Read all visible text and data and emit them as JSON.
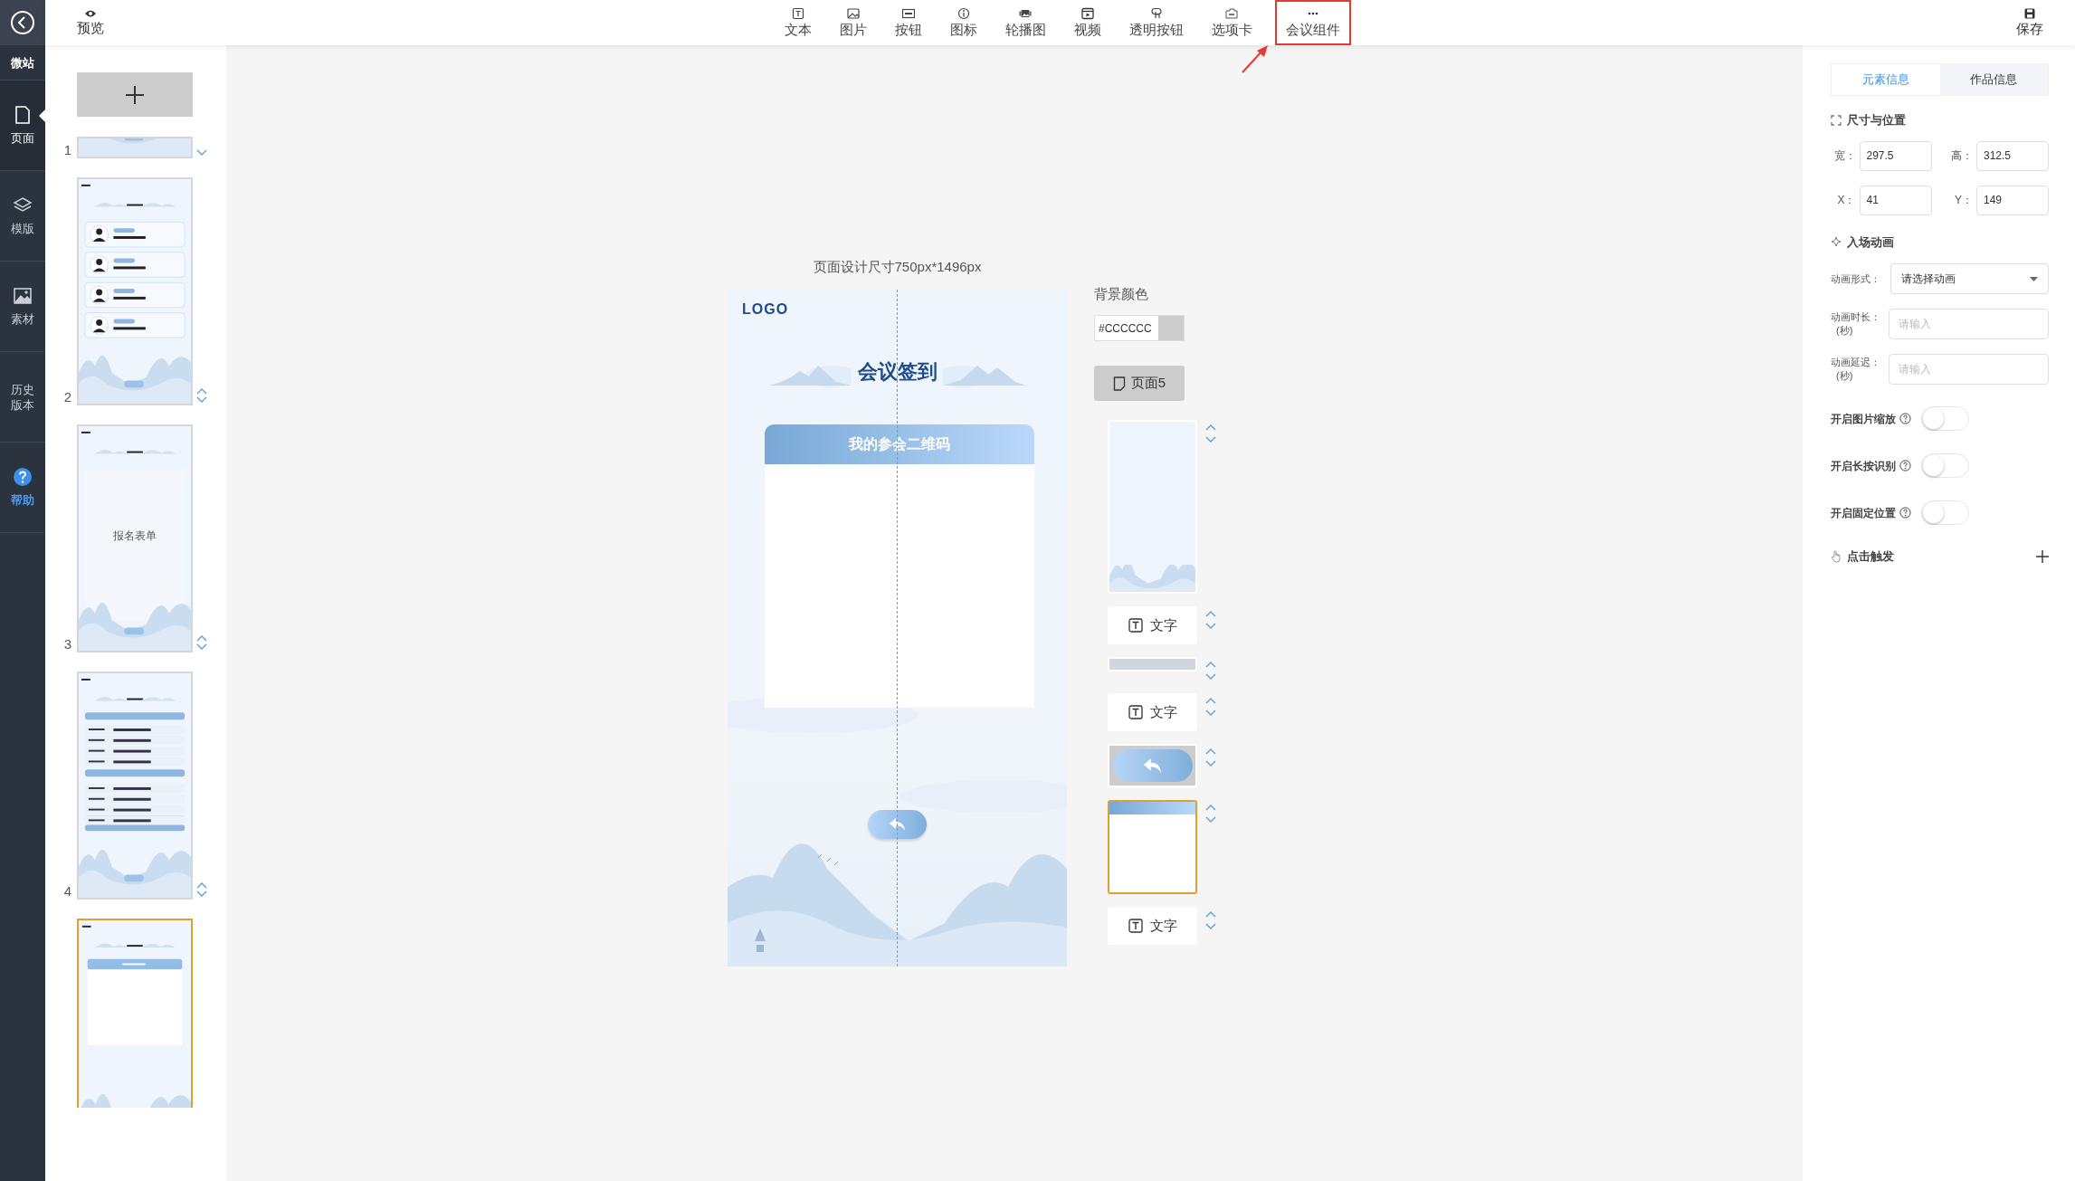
{
  "sidebar": {
    "items": [
      {
        "kind": "brand",
        "label": "微站",
        "selected": false
      },
      {
        "kind": "nav",
        "label": "页面",
        "selected": true
      },
      {
        "kind": "nav",
        "label": "模版",
        "selected": false
      },
      {
        "kind": "nav",
        "label": "素材",
        "selected": false
      },
      {
        "kind": "nav",
        "label": "历史版本",
        "selected": false
      },
      {
        "kind": "help",
        "label": "帮助",
        "selected": false
      }
    ]
  },
  "header": {
    "preview": "预览",
    "save": "保存",
    "tools": [
      {
        "label": "文本",
        "highlighted": false
      },
      {
        "label": "图片",
        "highlighted": false
      },
      {
        "label": "按钮",
        "highlighted": false
      },
      {
        "label": "图标",
        "highlighted": false
      },
      {
        "label": "轮播图",
        "highlighted": false
      },
      {
        "label": "视频",
        "highlighted": false
      },
      {
        "label": "透明按钮",
        "highlighted": false
      },
      {
        "label": "选项卡",
        "highlighted": false
      },
      {
        "label": "会议组件",
        "highlighted": true
      }
    ]
  },
  "pages": [
    {
      "kind": "banner",
      "number": "1",
      "selected": false,
      "can_move_up": false,
      "can_move_down": true
    },
    {
      "kind": "speakers",
      "number": "2",
      "selected": false,
      "can_move_up": true,
      "can_move_down": true
    },
    {
      "kind": "form",
      "number": "3",
      "caption": "报名表单",
      "selected": false,
      "can_move_up": true,
      "can_move_down": true
    },
    {
      "kind": "schedule",
      "number": "4",
      "selected": false,
      "can_move_up": true,
      "can_move_down": true
    },
    {
      "kind": "qrcode",
      "selected": true,
      "can_move_up": false,
      "can_move_down": false
    }
  ],
  "canvas": {
    "size_caption": "页面设计尺寸750px*1496px",
    "logo": "LOGO",
    "title": "会议签到",
    "card_title": "我的参会二维码"
  },
  "page_settings": {
    "background_label": "背景颜色",
    "background_value": "#CCCCCC",
    "page_button": "页面5"
  },
  "layers": [
    {
      "kind": "background",
      "selected": false
    },
    {
      "kind": "text",
      "label": "文字",
      "selected": false
    },
    {
      "kind": "image",
      "selected": false
    },
    {
      "kind": "text",
      "label": "文字",
      "selected": false
    },
    {
      "kind": "button",
      "selected": false
    },
    {
      "kind": "card",
      "selected": true
    },
    {
      "kind": "text",
      "label": "文字",
      "selected": false
    }
  ],
  "properties": {
    "tabs": [
      {
        "label": "元素信息",
        "selected": true
      },
      {
        "label": "作品信息",
        "selected": false
      }
    ],
    "size_section": "尺寸与位置",
    "fields": [
      {
        "label": "宽：",
        "value": "297.5"
      },
      {
        "label": "高：",
        "value": "312.5"
      },
      {
        "label": "X：",
        "value": "41"
      },
      {
        "label": "Y：",
        "value": "149"
      }
    ],
    "animation_section": "入场动画",
    "animation_fields": [
      {
        "kind": "select",
        "label": "动画形式：",
        "value": "请选择动画"
      },
      {
        "kind": "input",
        "label": "动画时长：",
        "sublabel": "(秒)",
        "placeholder": "请输入"
      },
      {
        "kind": "input",
        "label": "动画延迟：",
        "sublabel": "(秒)",
        "placeholder": "请输入"
      }
    ],
    "toggles": [
      {
        "label": "开启图片缩放",
        "on": false
      },
      {
        "label": "开启长按识别",
        "on": false
      },
      {
        "label": "开启固定位置",
        "on": false
      }
    ],
    "trigger_section": "点击触发"
  }
}
